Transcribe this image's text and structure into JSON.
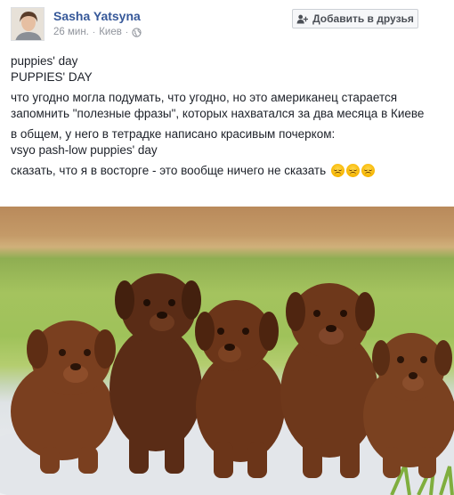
{
  "post": {
    "author": "Sasha Yatsyna",
    "time": "26 мин.",
    "location": "Киев",
    "add_friend_label": "Добавить в друзья",
    "lines": {
      "l1": "puppies' day",
      "l2": "PUPPIES' DAY",
      "l3": "что угодно могла подумать, что угодно, но это американец старается запомнить \"полезные фразы\", которых нахватался за два месяца в Киеве",
      "l4": "в общем, у него в тетрадке написано красивым почерком:",
      "l5": "vsyo pash-low puppies' day",
      "l6": "сказать, что я в восторге - это вообще ничего не сказать"
    },
    "emoji_count": 3,
    "icons": {
      "add_friend": "add-friend-icon",
      "privacy": "globe-icon",
      "emoji": "upside-down-smile-emoji"
    },
    "colors": {
      "author": "#365899",
      "meta": "#90949c",
      "text": "#1d2129"
    }
  }
}
